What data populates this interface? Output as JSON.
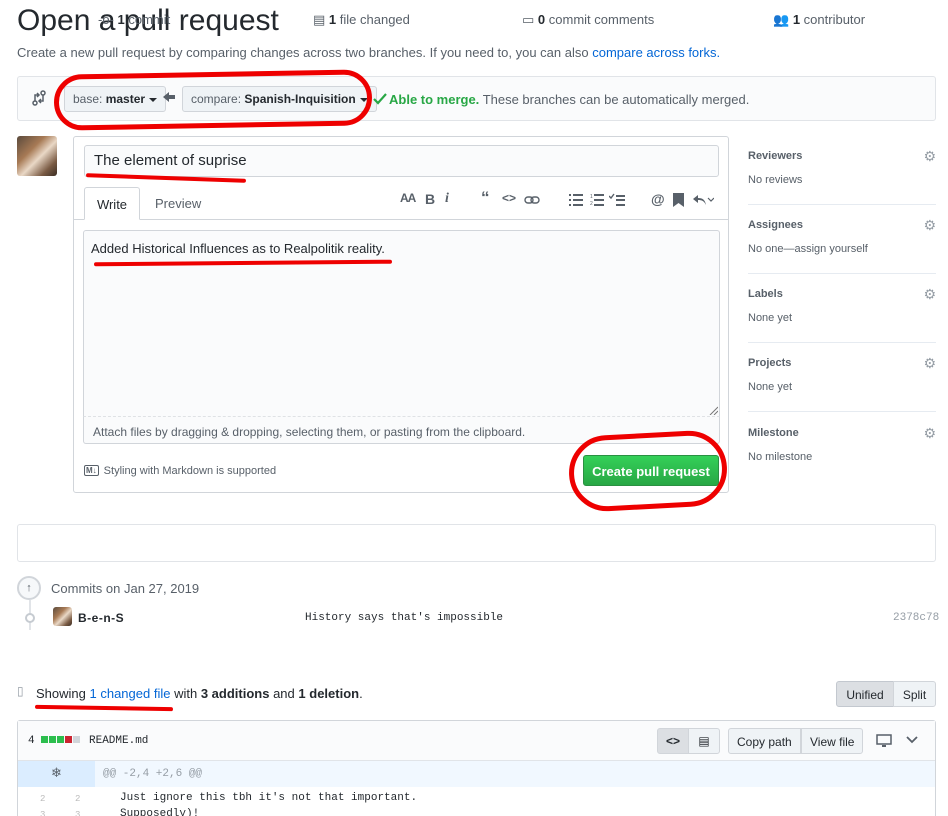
{
  "header": {
    "title": "Open a pull request",
    "subtitle": "Create a new pull request by comparing changes across two branches. If you need to, you can also",
    "subtitle_link": "compare across forks."
  },
  "range": {
    "base_prefix": "base:",
    "base_branch": "master",
    "compare_prefix": "compare:",
    "compare_branch": "Spanish-Inquisition",
    "merge_status": "Able to merge.",
    "merge_detail": "These branches can be automatically merged."
  },
  "composer": {
    "title_value": "The element of suprise",
    "tab_write": "Write",
    "tab_preview": "Preview",
    "body_value": "Added Historical Influences as to Realpolitik reality.",
    "attach_text": "Attach files by dragging & dropping, selecting them, or pasting from the clipboard.",
    "markdown_badge": "M↓",
    "markdown_note": "Styling with Markdown is supported",
    "submit_label": "Create pull request"
  },
  "sidebar": {
    "items": [
      {
        "title": "Reviewers",
        "value": "No reviews"
      },
      {
        "title": "Assignees",
        "value": "No one—assign yourself"
      },
      {
        "title": "Labels",
        "value": "None yet"
      },
      {
        "title": "Projects",
        "value": "None yet"
      },
      {
        "title": "Milestone",
        "value": "No milestone"
      }
    ]
  },
  "stats": {
    "commits_count": "1",
    "commits_label": "commit",
    "files_count": "1",
    "files_label": "file changed",
    "comments_count": "0",
    "comments_label": "commit comments",
    "contributors_count": "1",
    "contributors_label": "contributor"
  },
  "commits": {
    "date_label": "Commits on Jan 27, 2019",
    "author": "B-e-n-S",
    "message": "History says that's impossible",
    "sha": "2378c78"
  },
  "diff": {
    "showing_prefix": "Showing",
    "changed_link": "1 changed file",
    "with": "with",
    "additions": "3 additions",
    "and": "and",
    "deletions": "1 deletion",
    "unified_label": "Unified",
    "split_label": "Split",
    "file_change_count": "4",
    "file_name": "README.md",
    "copy_path_label": "Copy path",
    "view_file_label": "View file",
    "hunk_header": "@@ -2,4 +2,6 @@",
    "lines": [
      {
        "old": "2",
        "new": "2",
        "text": "Just ignore this tbh it's not that important."
      },
      {
        "old": "3",
        "new": "3",
        "text": "Supposedly)!"
      }
    ]
  },
  "colors": {
    "accent_link": "#0366d6",
    "merge_green": "#28a745",
    "annotation_red": "#e00000"
  }
}
